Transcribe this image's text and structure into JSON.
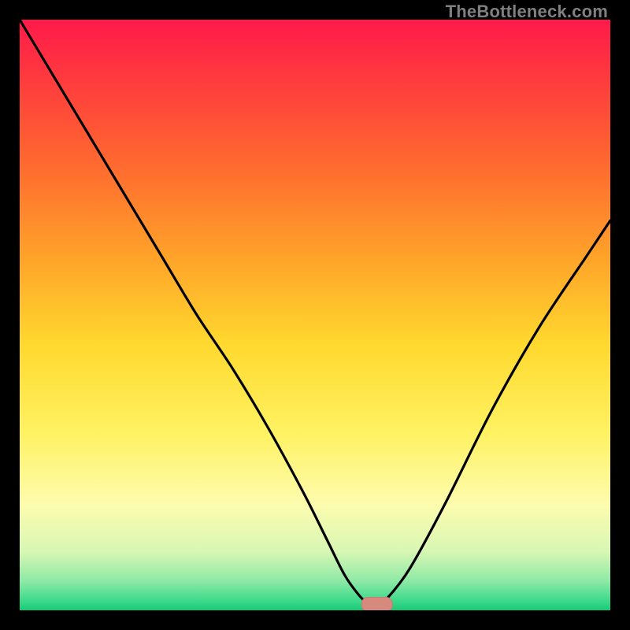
{
  "watermark": "TheBottleneck.com",
  "colors": {
    "frame": "#000000",
    "curve": "#000000",
    "marker_fill": "#D68A7E",
    "marker_stroke": "#CC7A6E"
  },
  "chart_data": {
    "type": "line",
    "title": "",
    "xlabel": "",
    "ylabel": "",
    "xlim": [
      0,
      100
    ],
    "ylim": [
      0,
      100
    ],
    "gradient_stops": [
      {
        "offset": 0.0,
        "color": "#ff1a4a"
      },
      {
        "offset": 0.1,
        "color": "#ff3a3e"
      },
      {
        "offset": 0.25,
        "color": "#ff6b2f"
      },
      {
        "offset": 0.4,
        "color": "#ffa229"
      },
      {
        "offset": 0.55,
        "color": "#ffd92e"
      },
      {
        "offset": 0.7,
        "color": "#fff262"
      },
      {
        "offset": 0.82,
        "color": "#fdfcae"
      },
      {
        "offset": 0.9,
        "color": "#d8f7b4"
      },
      {
        "offset": 0.95,
        "color": "#8fe9a6"
      },
      {
        "offset": 0.985,
        "color": "#39d98a"
      },
      {
        "offset": 1.0,
        "color": "#18c876"
      }
    ],
    "series": [
      {
        "name": "bottleneck-curve",
        "x": [
          0,
          6,
          12,
          18,
          24,
          30,
          36,
          42,
          48,
          52,
          55,
          57.5,
          59,
          60.5,
          62,
          66,
          72,
          80,
          88,
          96,
          100
        ],
        "y": [
          100,
          90,
          80,
          70,
          60,
          50,
          41,
          31,
          20,
          12,
          6,
          2.5,
          1.2,
          1.0,
          1.8,
          7,
          18,
          34,
          48,
          60,
          66
        ]
      }
    ],
    "marker": {
      "x": 60.5,
      "y": 1.0,
      "rx": 2.6,
      "ry": 1.2
    },
    "notes": "V-shaped bottleneck curve over vertical red→green gradient background. Axes unlabeled. Minimum near x≈60."
  }
}
